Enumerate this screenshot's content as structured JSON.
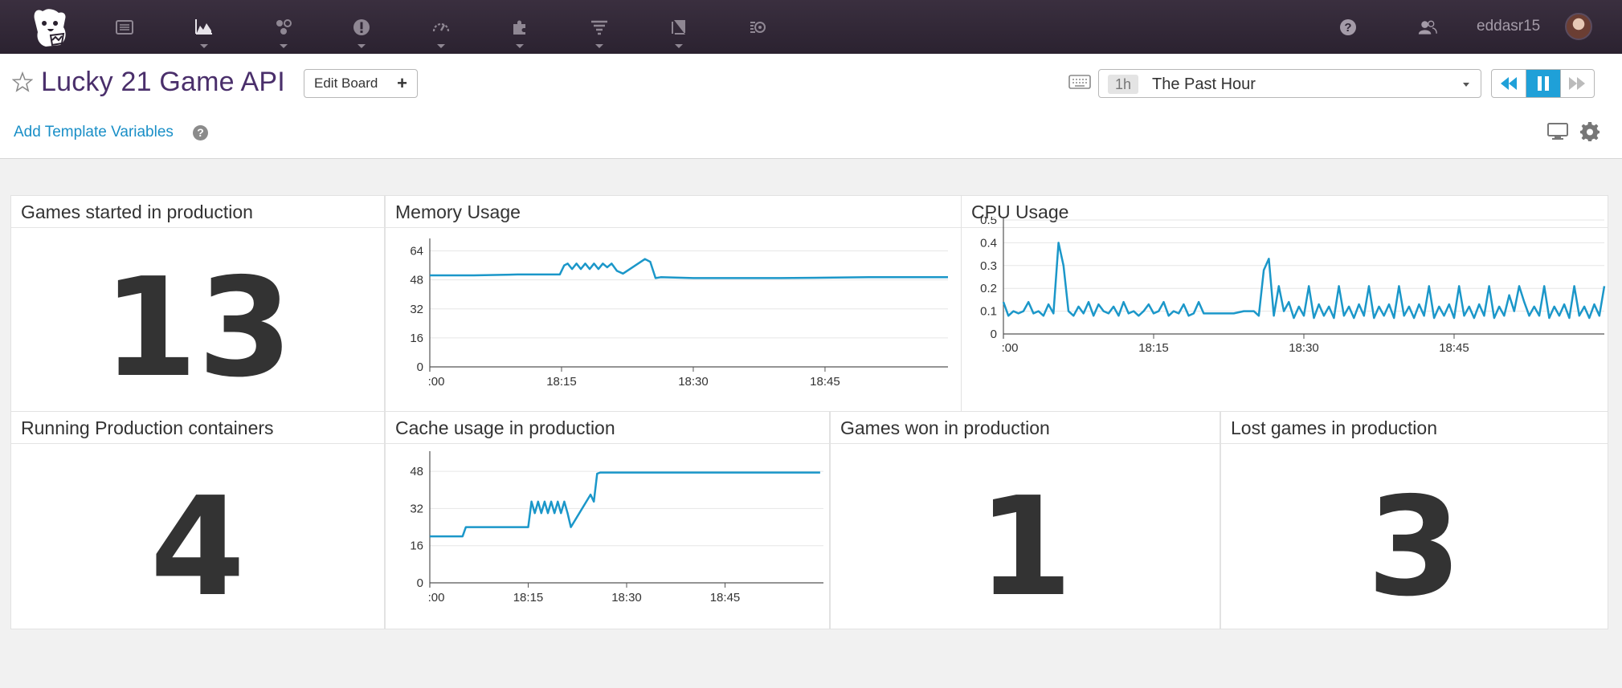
{
  "nav": {
    "items": [
      "dashboards",
      "metrics",
      "integrations",
      "monitors",
      "apm",
      "infrastructure",
      "logs",
      "notebooks",
      "synthetics"
    ],
    "username": "eddasr15"
  },
  "header": {
    "title": "Lucky 21 Game API",
    "edit_board_label": "Edit Board",
    "add_template_variables": "Add Template Variables",
    "help_glyph": "?"
  },
  "timepicker": {
    "short": "1h",
    "label": "The Past Hour"
  },
  "widgets": {
    "games_started": {
      "title": "Games started in production",
      "value": "13"
    },
    "running_containers": {
      "title": "Running Production containers",
      "value": "4"
    },
    "games_won": {
      "title": "Games won in production",
      "value": "1"
    },
    "lost_games": {
      "title": "Lost games in production",
      "value": "3"
    },
    "memory": {
      "title": "Memory Usage"
    },
    "cpu": {
      "title": "CPU Usage"
    },
    "cache": {
      "title": "Cache usage in production"
    }
  },
  "colors": {
    "accent": "#1fa0d8",
    "series": "#1b97c9",
    "title_purple": "#4a2f6b"
  },
  "chart_data": [
    {
      "id": "memory",
      "type": "line",
      "title": "Memory Usage",
      "xticks": [
        ":00",
        "18:15",
        "18:30",
        "18:45"
      ],
      "x_range": [
        0,
        59
      ],
      "yticks": [
        0,
        16,
        32,
        48,
        64
      ],
      "ylim": [
        0,
        70
      ],
      "x": [
        0,
        5,
        10,
        14.8,
        15.3,
        15.7,
        16.2,
        16.7,
        17.2,
        17.7,
        18.2,
        18.7,
        19.2,
        19.7,
        20.2,
        20.7,
        21.3,
        22,
        24.5,
        25.1,
        25.7,
        26.3,
        30,
        40,
        50,
        59
      ],
      "series": [
        {
          "values": [
            50.5,
            50.5,
            51,
            51,
            56,
            57,
            54,
            57,
            54,
            57,
            54,
            57,
            54,
            57,
            55,
            57,
            53,
            51.5,
            59.5,
            58,
            49,
            49.5,
            49,
            49,
            49.5,
            49.5
          ]
        }
      ]
    },
    {
      "id": "cpu",
      "type": "line",
      "title": "CPU Usage",
      "xticks": [
        ":00",
        "18:15",
        "18:30",
        "18:45"
      ],
      "x_range": [
        0,
        60
      ],
      "yticks": [
        0,
        0.1,
        0.2,
        0.3,
        0.4,
        0.5
      ],
      "ylim": [
        0,
        0.5
      ],
      "x": [
        0,
        0.5,
        1,
        1.5,
        2,
        2.5,
        3,
        3.5,
        4,
        4.5,
        5,
        5.5,
        6,
        6.5,
        7,
        7.5,
        8,
        8.5,
        9,
        9.5,
        10,
        10.5,
        11,
        11.5,
        12,
        12.5,
        13,
        13.5,
        14,
        14.5,
        15,
        15.5,
        16,
        16.5,
        17,
        17.5,
        18,
        18.5,
        19,
        19.5,
        20,
        21,
        22,
        23,
        24,
        25,
        25.5,
        26,
        26.5,
        27,
        27.5,
        28,
        28.5,
        29,
        29.5,
        30,
        30.5,
        31,
        31.5,
        32,
        32.5,
        33,
        33.5,
        34,
        34.5,
        35,
        35.5,
        36,
        36.5,
        37,
        37.5,
        38,
        38.5,
        39,
        39.5,
        40,
        40.5,
        41,
        41.5,
        42,
        42.5,
        43,
        43.5,
        44,
        44.5,
        45,
        45.5,
        46,
        46.5,
        47,
        47.5,
        48,
        48.5,
        49,
        49.5,
        50,
        50.5,
        51,
        51.5,
        52,
        52.5,
        53,
        53.5,
        54,
        54.5,
        55,
        55.5,
        56,
        56.5,
        57,
        57.5,
        58,
        58.5,
        59,
        59.5,
        60
      ],
      "series": [
        {
          "values": [
            0.14,
            0.08,
            0.1,
            0.09,
            0.1,
            0.14,
            0.09,
            0.1,
            0.08,
            0.13,
            0.09,
            0.4,
            0.3,
            0.1,
            0.08,
            0.12,
            0.09,
            0.14,
            0.08,
            0.13,
            0.1,
            0.09,
            0.12,
            0.08,
            0.14,
            0.09,
            0.1,
            0.08,
            0.1,
            0.13,
            0.09,
            0.1,
            0.14,
            0.08,
            0.1,
            0.09,
            0.13,
            0.08,
            0.09,
            0.14,
            0.09,
            0.09,
            0.09,
            0.09,
            0.1,
            0.1,
            0.08,
            0.28,
            0.33,
            0.08,
            0.21,
            0.1,
            0.14,
            0.07,
            0.12,
            0.08,
            0.21,
            0.07,
            0.13,
            0.08,
            0.12,
            0.07,
            0.21,
            0.08,
            0.12,
            0.07,
            0.13,
            0.08,
            0.21,
            0.07,
            0.12,
            0.08,
            0.13,
            0.07,
            0.21,
            0.08,
            0.12,
            0.07,
            0.13,
            0.08,
            0.21,
            0.07,
            0.12,
            0.08,
            0.13,
            0.07,
            0.21,
            0.08,
            0.12,
            0.07,
            0.13,
            0.08,
            0.21,
            0.07,
            0.12,
            0.08,
            0.17,
            0.1,
            0.21,
            0.14,
            0.08,
            0.12,
            0.08,
            0.21,
            0.07,
            0.12,
            0.08,
            0.13,
            0.07,
            0.21,
            0.08,
            0.12,
            0.07,
            0.13,
            0.08,
            0.21,
            0.08,
            0.06,
            0.1
          ]
        }
      ]
    },
    {
      "id": "cache",
      "type": "line",
      "title": "Cache usage in production",
      "xticks": [
        ":00",
        "18:15",
        "18:30",
        "18:45"
      ],
      "x_range": [
        0,
        60
      ],
      "yticks": [
        0,
        16,
        32,
        48
      ],
      "ylim": [
        0,
        56
      ],
      "x": [
        0,
        5,
        5.5,
        14.5,
        15,
        15.5,
        16,
        16.5,
        17,
        17.5,
        18,
        18.5,
        19,
        19.5,
        20,
        20.5,
        21,
        21.5,
        24.5,
        25,
        25.5,
        26,
        30,
        40,
        50,
        59.5
      ],
      "series": [
        {
          "values": [
            20,
            20,
            24,
            24,
            24,
            35,
            30,
            35,
            30,
            35,
            30,
            35,
            30,
            35,
            30,
            35,
            30,
            24,
            38,
            35,
            47,
            47.5,
            47.5,
            47.5,
            47.5,
            47.5
          ]
        }
      ]
    }
  ]
}
